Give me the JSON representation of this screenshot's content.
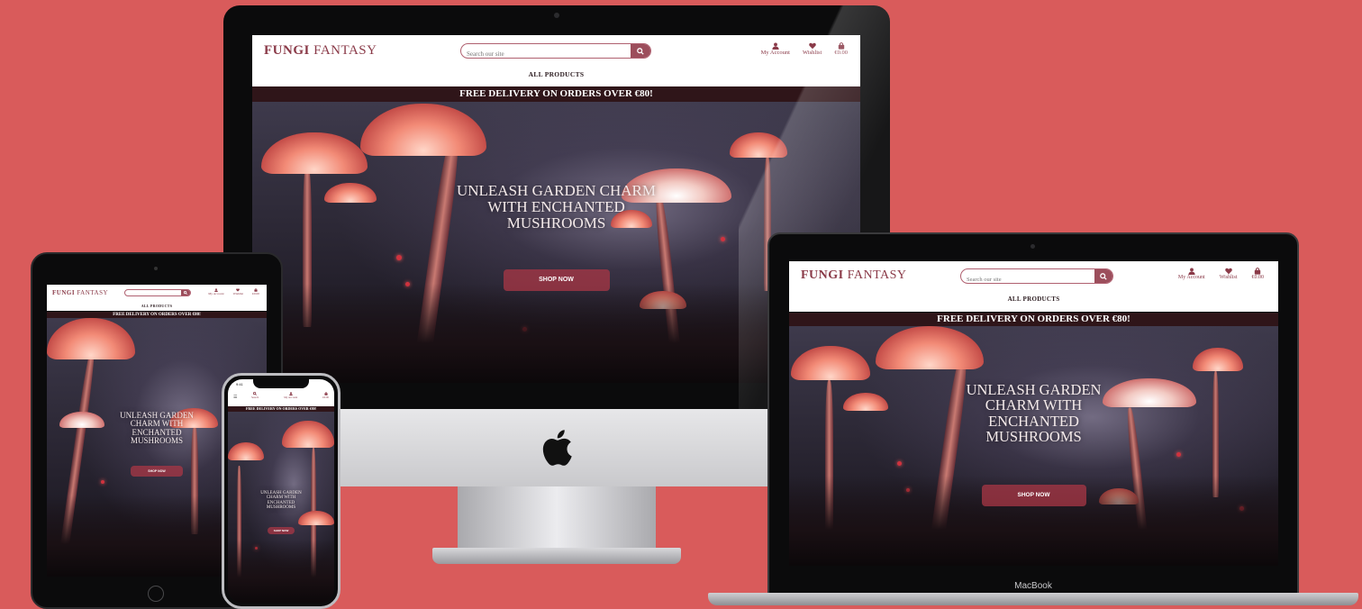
{
  "site": {
    "logo_bold": "FUNGI",
    "logo_rest": " FANTASY",
    "search_placeholder": "Search our site",
    "nav": {
      "account": "My Account",
      "wishlist": "Wishlist",
      "bag": "€0.00",
      "search": "Search"
    },
    "all_products": "ALL PRODUCTS",
    "banner": "FREE DELIVERY ON ORDERS OVER €80!",
    "hero": {
      "line1": "UNLEASH GARDEN",
      "line2": "CHARM WITH",
      "line3": "ENCHANTED",
      "line4": "MUSHROOMS",
      "imac_line1": "UNLEASH GARDEN CHARM",
      "imac_line2": "WITH ENCHANTED",
      "imac_line3": "MUSHROOMS",
      "shop": "SHOP NOW"
    }
  },
  "devices": {
    "macbook_label": "MacBook",
    "phone_time": "9:41"
  },
  "colors": {
    "background": "#d95b5b",
    "brand": "#8a3a48",
    "banner": "#2f1519"
  }
}
